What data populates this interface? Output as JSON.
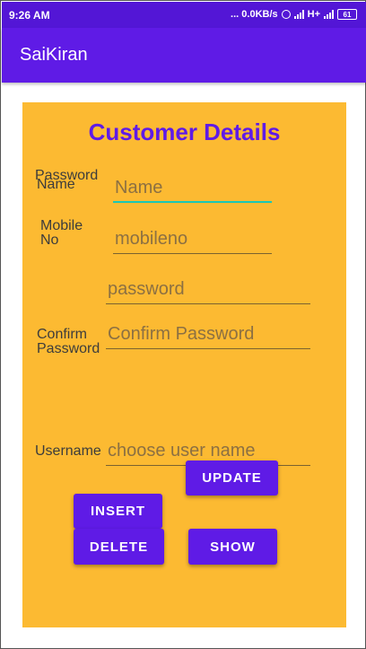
{
  "status_bar": {
    "time": "9:26 AM",
    "indicators": "... 0.0KB/s",
    "network": "H+",
    "battery": "61",
    "icons": [
      "alarm-icon",
      "signal-icon",
      "signal-icon",
      "battery-icon"
    ]
  },
  "app_bar": {
    "title": "SaiKiran"
  },
  "form": {
    "heading": "Customer Details",
    "fields": {
      "name": {
        "label": "Name",
        "placeholder": "Name",
        "value": ""
      },
      "mobile": {
        "label": "Mobile No",
        "placeholder": "mobileno",
        "value": ""
      },
      "password": {
        "label": "Password",
        "placeholder": "password",
        "value": ""
      },
      "confirm_password": {
        "label": "Confirm Password",
        "placeholder": "Confirm Password",
        "value": ""
      },
      "username": {
        "label": "Username",
        "placeholder": "choose user name",
        "value": ""
      }
    },
    "buttons": {
      "update": "UPDATE",
      "insert": "INSERT",
      "delete": "DELETE",
      "show": "SHOW"
    }
  },
  "colors": {
    "primary": "#5f1be6",
    "status_bar": "#5316d6",
    "card_background": "#fcba32",
    "focus_accent": "#1bc7b6"
  }
}
